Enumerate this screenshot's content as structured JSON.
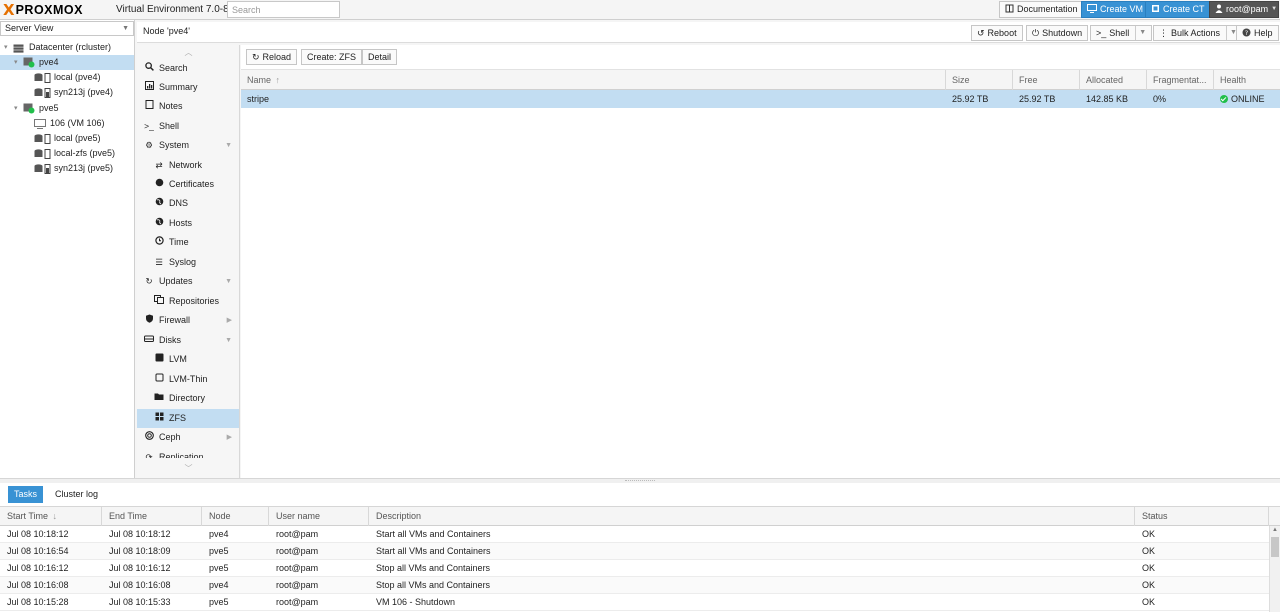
{
  "topbar": {
    "logo_mark": "X",
    "logo_text": "PROXMOX",
    "version": "Virtual Environment 7.0-8",
    "search_placeholder": "Search",
    "documentation": "Documentation",
    "create_vm": "Create VM",
    "create_ct": "Create CT",
    "user": "root@pam"
  },
  "tree": {
    "view": "Server View",
    "items": [
      {
        "label": "Datacenter (rcluster)",
        "icon": "datacenter-icon"
      },
      {
        "label": "pve4",
        "icon": "node-online-icon",
        "selected": true
      },
      {
        "label": "local (pve4)",
        "icon": "storage-icon"
      },
      {
        "label": "syn213j (pve4)",
        "icon": "storage-icon"
      },
      {
        "label": "pve5",
        "icon": "node-online-icon"
      },
      {
        "label": "106 (VM 106)",
        "icon": "vm-icon"
      },
      {
        "label": "local (pve5)",
        "icon": "storage-icon"
      },
      {
        "label": "local-zfs (pve5)",
        "icon": "storage-icon"
      },
      {
        "label": "syn213j (pve5)",
        "icon": "storage-icon"
      }
    ]
  },
  "header": {
    "title": "Node 'pve4'",
    "reboot": "Reboot",
    "shutdown": "Shutdown",
    "shell": "Shell",
    "bulk_actions": "Bulk Actions",
    "help": "Help"
  },
  "menu": {
    "items": [
      {
        "label": "Search",
        "icon": "search-icon"
      },
      {
        "label": "Summary",
        "icon": "summary-icon"
      },
      {
        "label": "Notes",
        "icon": "notes-icon"
      },
      {
        "label": "Shell",
        "icon": "terminal-icon"
      },
      {
        "label": "System",
        "icon": "gears-icon"
      },
      {
        "label": "Network",
        "icon": "network-icon"
      },
      {
        "label": "Certificates",
        "icon": "certificate-icon"
      },
      {
        "label": "DNS",
        "icon": "globe-icon"
      },
      {
        "label": "Hosts",
        "icon": "globe-icon"
      },
      {
        "label": "Time",
        "icon": "clock-icon"
      },
      {
        "label": "Syslog",
        "icon": "list-icon"
      },
      {
        "label": "Updates",
        "icon": "refresh-icon"
      },
      {
        "label": "Repositories",
        "icon": "repositories-icon"
      },
      {
        "label": "Firewall",
        "icon": "shield-icon"
      },
      {
        "label": "Disks",
        "icon": "hdd-icon"
      },
      {
        "label": "LVM",
        "icon": "lvm-icon"
      },
      {
        "label": "LVM-Thin",
        "icon": "lvm-thin-icon"
      },
      {
        "label": "Directory",
        "icon": "folder-icon"
      },
      {
        "label": "ZFS",
        "icon": "zfs-icon",
        "selected": true
      },
      {
        "label": "Ceph",
        "icon": "ceph-icon"
      },
      {
        "label": "Replication",
        "icon": "replication-icon"
      }
    ]
  },
  "content": {
    "reload": "Reload",
    "create_zfs": "Create: ZFS",
    "detail": "Detail",
    "columns": [
      "Name",
      "Size",
      "Free",
      "Allocated",
      "Fragmentat...",
      "Health"
    ],
    "rows": [
      {
        "name": "stripe",
        "size": "25.92 TB",
        "free": "25.92 TB",
        "allocated": "142.85 KB",
        "fragmentation": "0%",
        "health": "ONLINE"
      }
    ],
    "health_color": "#21bf4b"
  },
  "tasks": {
    "tab_tasks": "Tasks",
    "tab_cluster_log": "Cluster log",
    "columns": [
      "Start Time",
      "End Time",
      "Node",
      "User name",
      "Description",
      "Status"
    ],
    "rows": [
      {
        "start": "Jul 08 10:18:12",
        "end": "Jul 08 10:18:12",
        "node": "pve4",
        "user": "root@pam",
        "desc": "Start all VMs and Containers",
        "status": "OK"
      },
      {
        "start": "Jul 08 10:16:54",
        "end": "Jul 08 10:18:09",
        "node": "pve5",
        "user": "root@pam",
        "desc": "Start all VMs and Containers",
        "status": "OK"
      },
      {
        "start": "Jul 08 10:16:12",
        "end": "Jul 08 10:16:12",
        "node": "pve5",
        "user": "root@pam",
        "desc": "Stop all VMs and Containers",
        "status": "OK"
      },
      {
        "start": "Jul 08 10:16:08",
        "end": "Jul 08 10:16:08",
        "node": "pve4",
        "user": "root@pam",
        "desc": "Stop all VMs and Containers",
        "status": "OK"
      },
      {
        "start": "Jul 08 10:15:28",
        "end": "Jul 08 10:15:33",
        "node": "pve5",
        "user": "root@pam",
        "desc": "VM 106 - Shutdown",
        "status": "OK"
      }
    ]
  },
  "colors": {
    "accent": "#3892d4",
    "selection": "#c2ddf2",
    "logo_orange": "#e57000"
  }
}
